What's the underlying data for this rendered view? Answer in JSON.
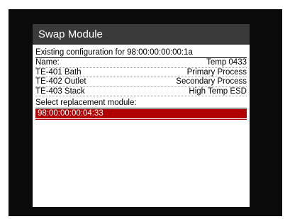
{
  "dialog": {
    "title": "Swap Module"
  },
  "existing": {
    "heading": "Existing configuration for 98:00:00:00:00:1a",
    "rows": [
      {
        "label": "Name:",
        "value": "Temp 0433"
      },
      {
        "label": "TE-401 Bath",
        "value": "Primary Process"
      },
      {
        "label": "TE-402 Outlet",
        "value": "Secondary Process"
      },
      {
        "label": "TE-403 Stack",
        "value": "High Temp ESD"
      }
    ]
  },
  "replacement": {
    "heading": "Select replacement module:",
    "modules": [
      {
        "id": "98:00:00:00:04:33",
        "selected": true
      }
    ]
  },
  "colors": {
    "titlebar": "#3a3a3a",
    "selection": "#b00000",
    "frame": "#0a0a0a"
  }
}
